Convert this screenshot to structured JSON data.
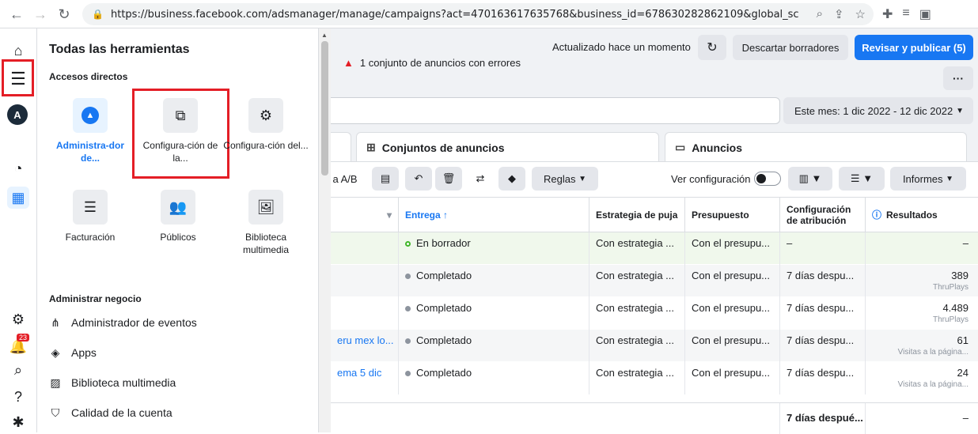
{
  "browser": {
    "url": "https://business.facebook.com/adsmanager/manage/campaigns?act=470163617635768&business_id=678630282862109&global_scope_i..."
  },
  "rail": {
    "avatar_letter": "A",
    "notification_count": "23"
  },
  "panel": {
    "title": "Todas las herramientas",
    "shortcuts_title": "Accesos directos",
    "tiles": [
      {
        "label": "Administra-dor de..."
      },
      {
        "label": "Configura-ción de la..."
      },
      {
        "label": "Configura-ción del..."
      },
      {
        "label": "Facturación"
      },
      {
        "label": "Públicos"
      },
      {
        "label": "Biblioteca multimedia"
      }
    ],
    "business_title": "Administrar negocio",
    "business_items": [
      {
        "label": "Administrador de eventos"
      },
      {
        "label": "Apps"
      },
      {
        "label": "Biblioteca multimedia"
      },
      {
        "label": "Calidad de la cuenta"
      }
    ]
  },
  "header": {
    "updated": "Actualizado hace un momento",
    "discard": "Descartar borradores",
    "publish": "Revisar y publicar (5)",
    "error": "1 conjunto de anuncios con errores",
    "more": "···",
    "date_range": "Este mes: 1 dic 2022 - 12 dic 2022"
  },
  "tabs": {
    "adsets": "Conjuntos de anuncios",
    "ads": "Anuncios"
  },
  "toolbar": {
    "ab": "a A/B",
    "rules": "Reglas",
    "config": "Ver configuración",
    "reports": "Informes"
  },
  "columns": {
    "delivery": "Entrega ↑",
    "bid": "Estrategia de puja",
    "budget": "Presupuesto",
    "attribution": "Configuración de atribución",
    "results": "Resultados"
  },
  "rows": [
    {
      "name": "",
      "delivery": "En borrador",
      "bid": "Con estrategia ...",
      "budget": "Con el presupu...",
      "attribution": "–",
      "result": "–",
      "result_sub": ""
    },
    {
      "name": "",
      "delivery": "Completado",
      "bid": "Con estrategia ...",
      "budget": "Con el presupu...",
      "attribution": "7 días despu...",
      "result": "389",
      "result_sub": "ThruPlays"
    },
    {
      "name": "",
      "delivery": "Completado",
      "bid": "Con estrategia ...",
      "budget": "Con el presupu...",
      "attribution": "7 días despu...",
      "result": "4.489",
      "result_sub": "ThruPlays"
    },
    {
      "name": "eru mex lo...",
      "delivery": "Completado",
      "bid": "Con estrategia ...",
      "budget": "Con el presupu...",
      "attribution": "7 días despu...",
      "result": "61",
      "result_sub": "Visitas a la página..."
    },
    {
      "name": "ema 5 dic",
      "delivery": "Completado",
      "bid": "Con estrategia ...",
      "budget": "Con el presupu...",
      "attribution": "7 días despu...",
      "result": "24",
      "result_sub": "Visitas a la página..."
    }
  ],
  "footer": {
    "attribution": "7 días despué...",
    "result": "–"
  }
}
